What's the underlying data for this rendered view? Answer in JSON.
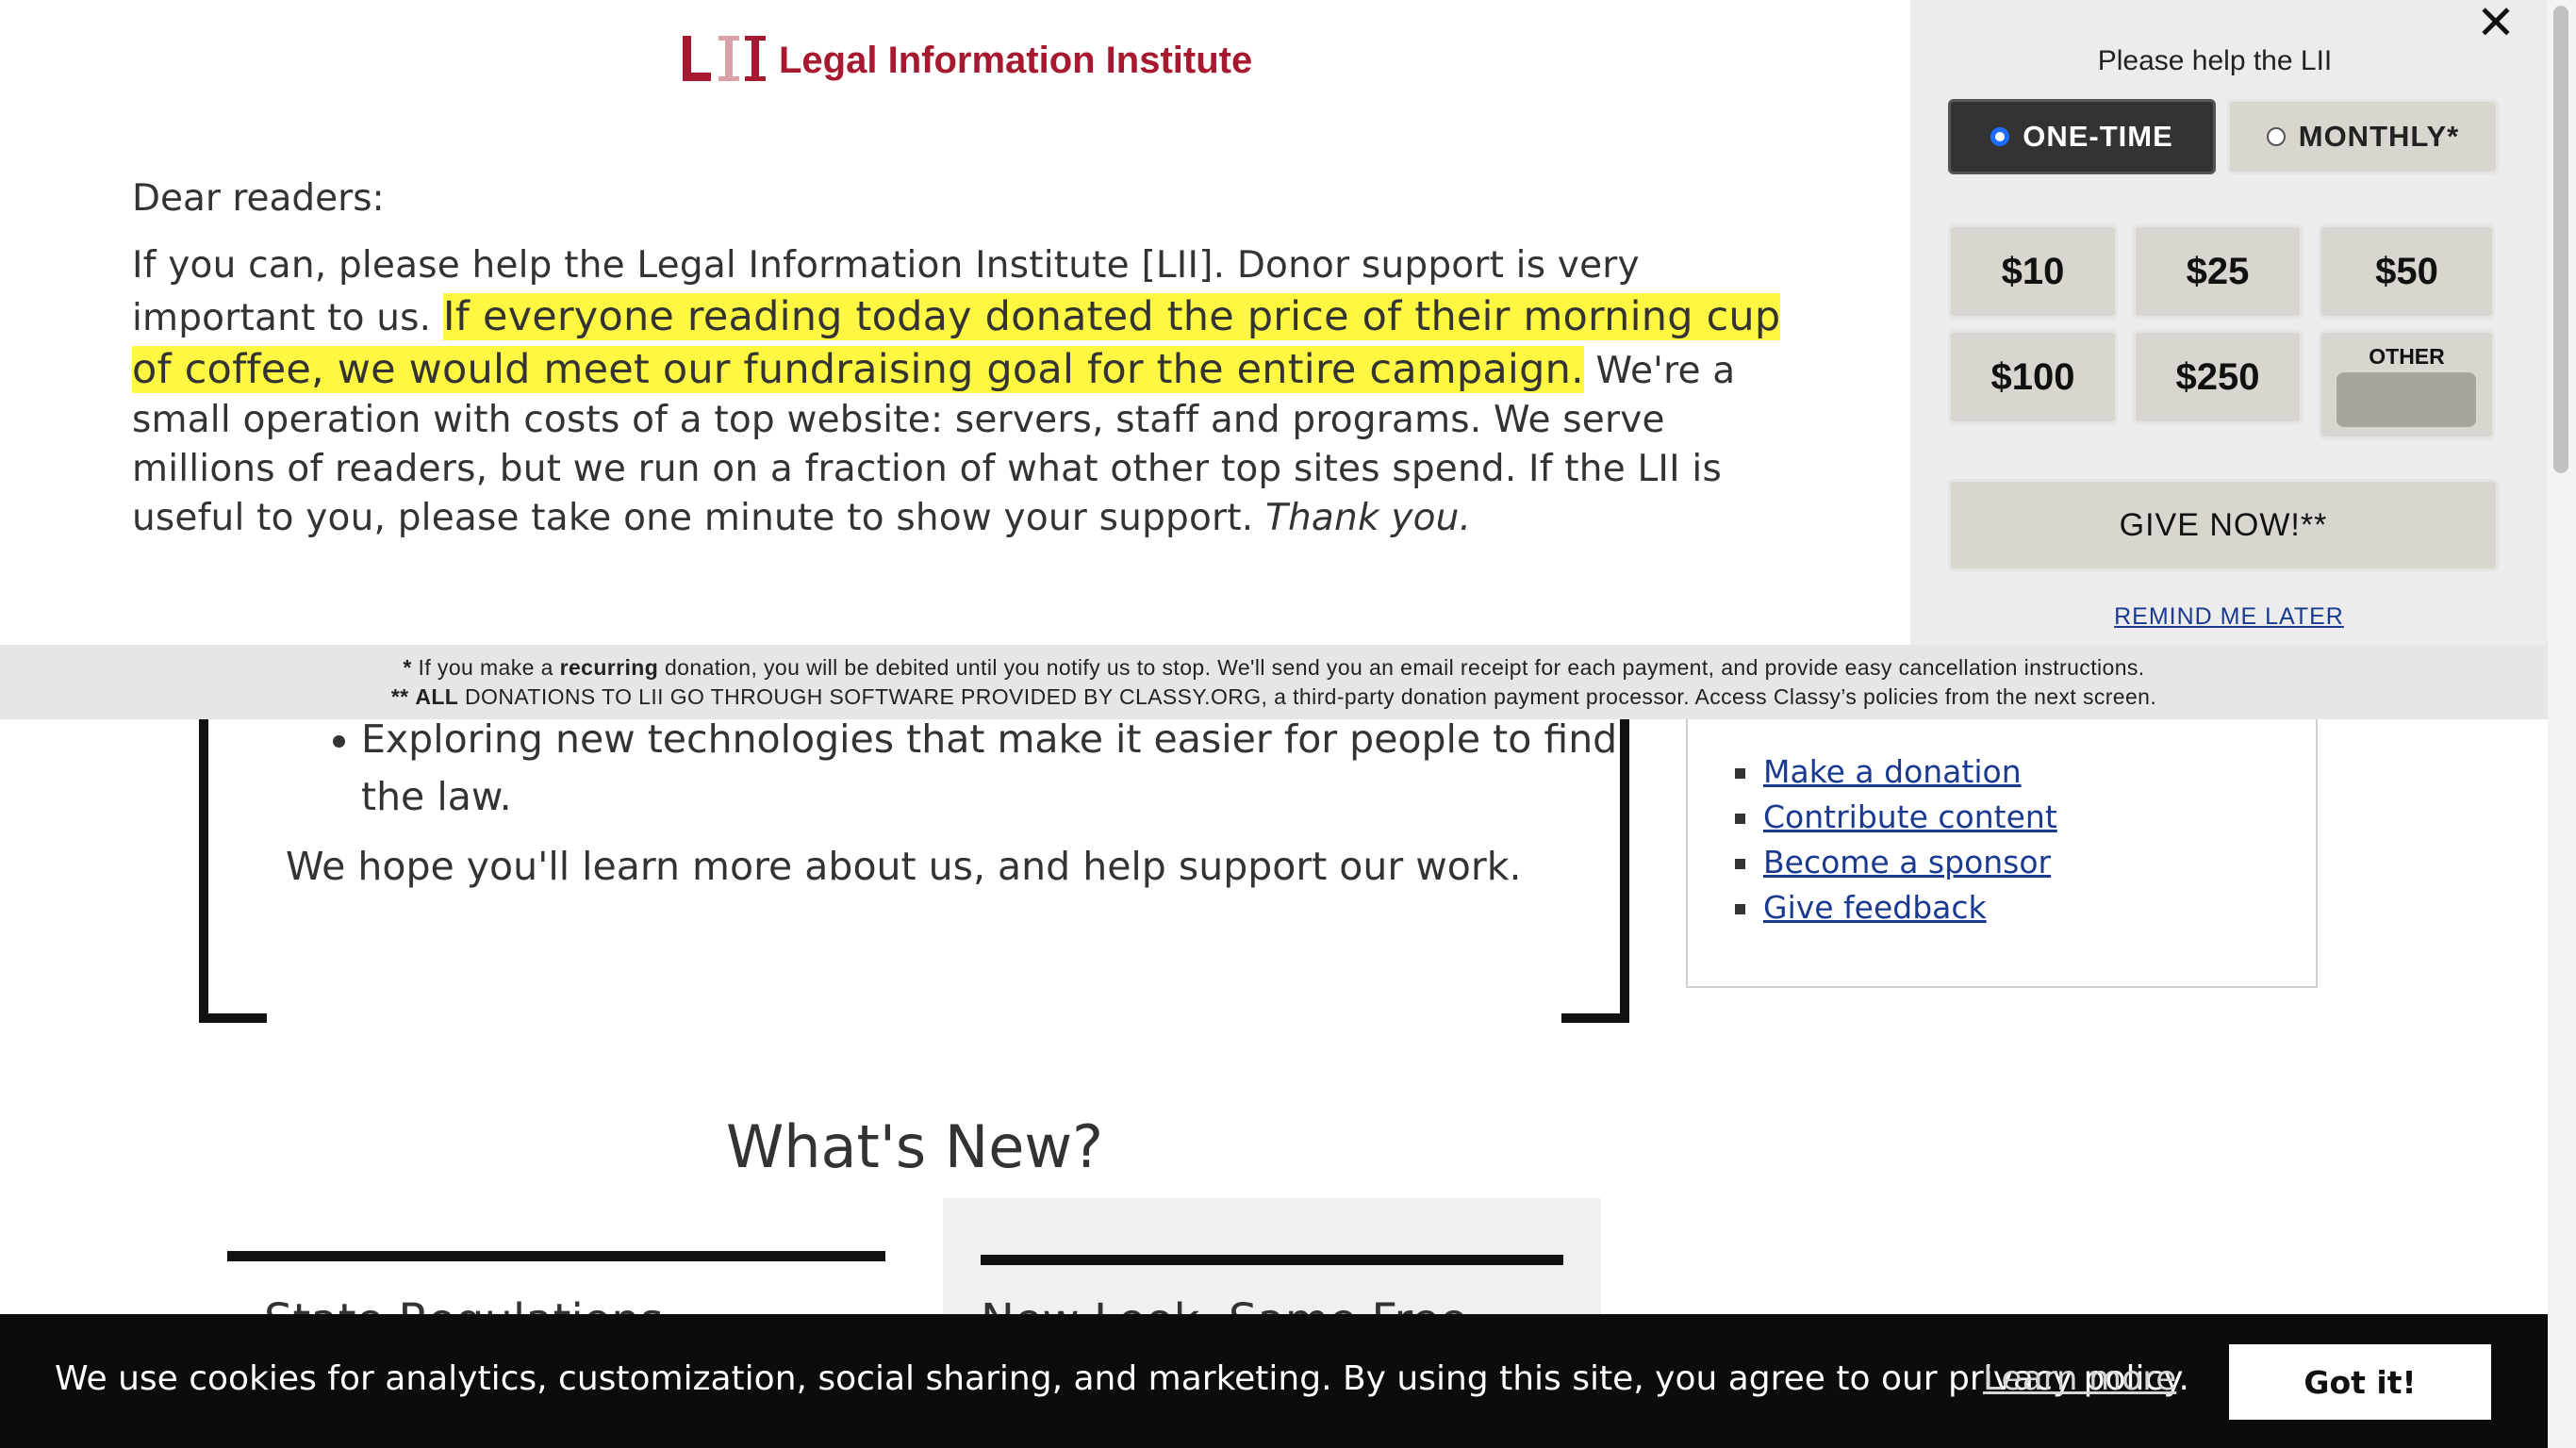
{
  "page": {
    "about": {
      "bullet": "Exploring new technologies that make it easier for people to find the law.",
      "hope": "We hope you'll learn more about us, and help support our work."
    },
    "sidebar_links": [
      "Make a donation",
      "Contribute content",
      "Become a sponsor",
      "Give feedback"
    ],
    "whats_new": {
      "heading": "What's New?",
      "card1_title": "State Regulations",
      "card2_title": "New Look, Same Free"
    }
  },
  "banner": {
    "logo": {
      "mark": "LII",
      "name": "Legal Information Institute"
    },
    "greeting": "Dear readers:",
    "appeal": {
      "part1": "If you can, please help the Legal Information Institute [LII]. Donor support is very important to us.",
      "highlight": "If everyone reading today donated the price of their morning cup of coffee, we would meet our fundraising goal for the entire campaign.",
      "part2": "We're a small operation with costs of a top website: servers, staff and programs. We serve millions of readers, but we run on a fraction of what other top sites spend. If the LII is useful to you, please take one minute to show your support.",
      "thanks": "Thank you."
    },
    "side": {
      "close": "✕",
      "title": "Please help the LII",
      "frequency": {
        "one_time": "ONE-TIME",
        "monthly": "MONTHLY*",
        "selected": "ONE-TIME"
      },
      "amounts": [
        "$10",
        "$25",
        "$50",
        "$100",
        "$250"
      ],
      "other_label": "OTHER",
      "other_value": "",
      "give_now": "GIVE NOW!**",
      "remind_later": "REMIND ME LATER"
    },
    "footnote": {
      "line1_star": "*",
      "line1_pre": " If you make a ",
      "line1_bold": "recurring",
      "line1_post": " donation, you will be debited until you notify us to stop. We'll send you an email receipt for each payment, and provide easy cancellation instructions.",
      "line2_stars": "**",
      "line2_bold": "ALL",
      "line2_post": " DONATIONS TO LII GO THROUGH SOFTWARE PROVIDED BY CLASSY.ORG, a third-party donation payment processor. Access Classy’s policies from the next screen."
    }
  },
  "cookie": {
    "text": "We use cookies for analytics, customization, social sharing, and marketing. By using this site, you agree to our privacy policy.",
    "learn_more": "Learn more",
    "accept": "Got it!"
  },
  "colors": {
    "logo_red": "#a6192e",
    "highlight": "#fff741",
    "link_blue": "#1a3a8f",
    "radio_blue": "#1e6bff",
    "donate_button": "#d9d6cf"
  }
}
